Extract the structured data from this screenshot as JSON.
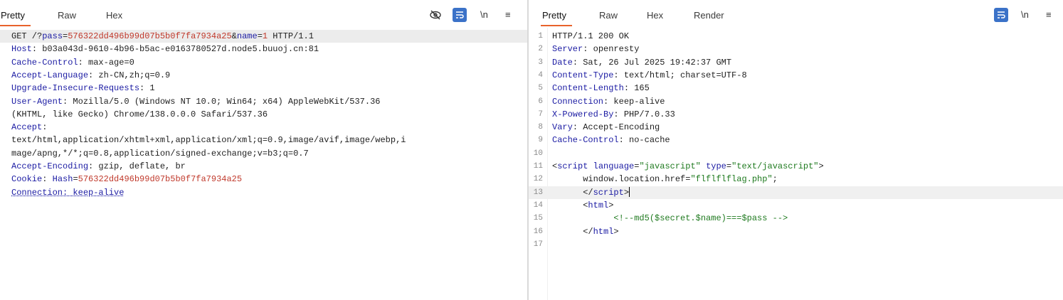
{
  "request": {
    "tabs": [
      "Pretty",
      "Raw",
      "Hex"
    ],
    "active_tab": "Pretty",
    "tools": {
      "eye_off": "eye-off-icon",
      "wrap": "wrap-icon",
      "newline": "\\n",
      "menu": "≡"
    },
    "lines": [
      {
        "parts": [
          {
            "t": "GET /?",
            "c": "hv"
          },
          {
            "t": "pass",
            "c": "hk"
          },
          {
            "t": "=",
            "c": "hv"
          },
          {
            "t": "576322dd496b99d07b5b0f7fa7934a25",
            "c": "red"
          },
          {
            "t": "&",
            "c": "hv"
          },
          {
            "t": "name",
            "c": "hk"
          },
          {
            "t": "=",
            "c": "hv"
          },
          {
            "t": "1",
            "c": "red"
          },
          {
            "t": " HTTP/1.1",
            "c": "hv"
          }
        ]
      },
      {
        "parts": [
          {
            "t": "Host",
            "c": "hk"
          },
          {
            "t": ": b03a043d-9610-4b96-b5ac-e0163780527d.node5.buuoj.cn:81",
            "c": "hv"
          }
        ]
      },
      {
        "parts": [
          {
            "t": "Cache-Control",
            "c": "hk"
          },
          {
            "t": ": max-age=0",
            "c": "hv"
          }
        ]
      },
      {
        "parts": [
          {
            "t": "Accept-Language",
            "c": "hk"
          },
          {
            "t": ": zh-CN,zh;q=0.9",
            "c": "hv"
          }
        ]
      },
      {
        "parts": [
          {
            "t": "Upgrade-Insecure-Requests",
            "c": "hk"
          },
          {
            "t": ": 1",
            "c": "hv"
          }
        ]
      },
      {
        "parts": [
          {
            "t": "User-Agent",
            "c": "hk"
          },
          {
            "t": ": Mozilla/5.0 (Windows NT 10.0; Win64; x64) AppleWebKit/537.36",
            "c": "hv"
          }
        ]
      },
      {
        "parts": [
          {
            "t": "(KHTML, like Gecko) Chrome/138.0.0.0 Safari/537.36",
            "c": "hv"
          }
        ]
      },
      {
        "parts": [
          {
            "t": "Accept",
            "c": "hk"
          },
          {
            "t": ":",
            "c": "hv"
          }
        ]
      },
      {
        "parts": [
          {
            "t": "text/html,application/xhtml+xml,application/xml;q=0.9,image/avif,image/webp,i",
            "c": "hv"
          }
        ]
      },
      {
        "parts": [
          {
            "t": "mage/apng,*/*;q=0.8,application/signed-exchange;v=b3;q=0.7",
            "c": "hv"
          }
        ]
      },
      {
        "parts": [
          {
            "t": "Accept-Encoding",
            "c": "hk"
          },
          {
            "t": ": gzip, deflate, br",
            "c": "hv"
          }
        ]
      },
      {
        "parts": [
          {
            "t": "Cookie",
            "c": "hk"
          },
          {
            "t": ": ",
            "c": "hv"
          },
          {
            "t": "Hash",
            "c": "hk"
          },
          {
            "t": "=",
            "c": "hv"
          },
          {
            "t": "576322dd496b99d07b5b0f7fa7934a25",
            "c": "red"
          }
        ]
      },
      {
        "parts": [
          {
            "t": "Connection: keep-alive",
            "c": "hk underline"
          }
        ]
      }
    ]
  },
  "response": {
    "tabs": [
      "Pretty",
      "Raw",
      "Hex",
      "Render"
    ],
    "active_tab": "Pretty",
    "tools": {
      "wrap": "wrap-icon",
      "newline": "\\n",
      "menu": "≡"
    },
    "lines": [
      {
        "n": "1",
        "parts": [
          {
            "t": "HTTP/1.1 200 OK",
            "c": "hv"
          }
        ]
      },
      {
        "n": "2",
        "parts": [
          {
            "t": "Server",
            "c": "hk"
          },
          {
            "t": ": openresty",
            "c": "hv"
          }
        ]
      },
      {
        "n": "3",
        "parts": [
          {
            "t": "Date",
            "c": "hk"
          },
          {
            "t": ": Sat, 26 Jul 2025 19:42:37 GMT",
            "c": "hv"
          }
        ]
      },
      {
        "n": "4",
        "parts": [
          {
            "t": "Content-Type",
            "c": "hk"
          },
          {
            "t": ": text/html; charset=UTF-8",
            "c": "hv"
          }
        ]
      },
      {
        "n": "5",
        "parts": [
          {
            "t": "Content-Length",
            "c": "hk"
          },
          {
            "t": ": 165",
            "c": "hv"
          }
        ]
      },
      {
        "n": "6",
        "parts": [
          {
            "t": "Connection",
            "c": "hk"
          },
          {
            "t": ": keep-alive",
            "c": "hv"
          }
        ]
      },
      {
        "n": "7",
        "parts": [
          {
            "t": "X-Powered-By",
            "c": "hk"
          },
          {
            "t": ": PHP/7.0.33",
            "c": "hv"
          }
        ]
      },
      {
        "n": "8",
        "parts": [
          {
            "t": "Vary",
            "c": "hk"
          },
          {
            "t": ": Accept-Encoding",
            "c": "hv"
          }
        ]
      },
      {
        "n": "9",
        "parts": [
          {
            "t": "Cache-Control",
            "c": "hk"
          },
          {
            "t": ": no-cache",
            "c": "hv"
          }
        ]
      },
      {
        "n": "10",
        "parts": []
      },
      {
        "n": "11",
        "parts": [
          {
            "t": "<",
            "c": "hv"
          },
          {
            "t": "script",
            "c": "tag"
          },
          {
            "t": " ",
            "c": "hv"
          },
          {
            "t": "language",
            "c": "attr"
          },
          {
            "t": "=",
            "c": "hv"
          },
          {
            "t": "\"javascript\"",
            "c": "str"
          },
          {
            "t": " ",
            "c": "hv"
          },
          {
            "t": "type",
            "c": "attr"
          },
          {
            "t": "=",
            "c": "hv"
          },
          {
            "t": "\"text/javascript\"",
            "c": "str"
          },
          {
            "t": ">",
            "c": "hv"
          }
        ]
      },
      {
        "n": "12",
        "parts": [
          {
            "t": "      window.location.href=",
            "c": "hv"
          },
          {
            "t": "\"flflflflag.php\"",
            "c": "str"
          },
          {
            "t": ";",
            "c": "hv"
          }
        ]
      },
      {
        "n": "13",
        "parts": [
          {
            "t": "      </",
            "c": "hv"
          },
          {
            "t": "script",
            "c": "tag"
          },
          {
            "t": ">",
            "c": "hv"
          }
        ],
        "cursor": true
      },
      {
        "n": "14",
        "parts": [
          {
            "t": "      <",
            "c": "hv"
          },
          {
            "t": "html",
            "c": "tag"
          },
          {
            "t": ">",
            "c": "hv"
          }
        ]
      },
      {
        "n": "15",
        "parts": [
          {
            "t": "            <!--md5($secret.$name)===$pass -->",
            "c": "cmt"
          }
        ]
      },
      {
        "n": "16",
        "parts": [
          {
            "t": "      </",
            "c": "hv"
          },
          {
            "t": "html",
            "c": "tag"
          },
          {
            "t": ">",
            "c": "hv"
          }
        ]
      },
      {
        "n": "17",
        "parts": []
      }
    ]
  },
  "colors": {
    "accent": "#e8622c",
    "wrap_button": "#3b72c8"
  }
}
